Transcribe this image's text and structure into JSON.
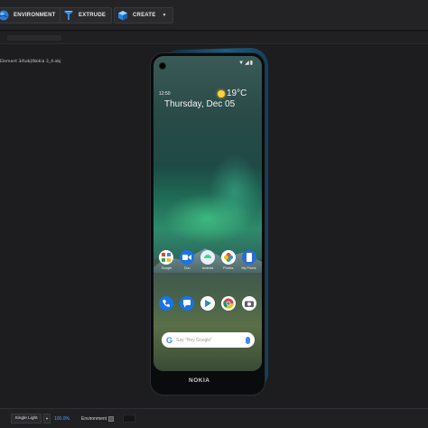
{
  "toolbar": {
    "environment_label": "ENVIRONMENT",
    "extrude_label": "EXTRUDE",
    "create_label": "CREATE",
    "create_dropdown_icon": "chevron-down-icon"
  },
  "viewport": {
    "file_path": "Element 3d\\obj\\Nokia 3_4.obj"
  },
  "phone": {
    "brand": "NOKIA",
    "status_icons": "▼◢▮",
    "clock": "12:50",
    "date": "Thursday, Dec 05",
    "temperature": "19°C",
    "apps_row1": [
      {
        "label": "Google",
        "icon": "google-apps-icon"
      },
      {
        "label": "Duo",
        "icon": "duo-icon"
      },
      {
        "label": "Android",
        "icon": "android-icon"
      },
      {
        "label": "Photos",
        "icon": "photos-icon"
      },
      {
        "label": "My Phone",
        "icon": "myphone-icon"
      }
    ],
    "apps_row2": [
      {
        "label": "",
        "icon": "phone-icon"
      },
      {
        "label": "",
        "icon": "messages-icon"
      },
      {
        "label": "",
        "icon": "play-store-icon"
      },
      {
        "label": "",
        "icon": "chrome-icon"
      },
      {
        "label": "",
        "icon": "camera-icon"
      }
    ],
    "search_placeholder": "Say \"Hey Google\"",
    "search_logo": "G"
  },
  "bottombar": {
    "light_label": "Single Light",
    "zoom": "100.0%",
    "environment_label": "Environment"
  },
  "colors": {
    "accent": "#4aa3ff",
    "phone_frame": "#1a5d86"
  }
}
